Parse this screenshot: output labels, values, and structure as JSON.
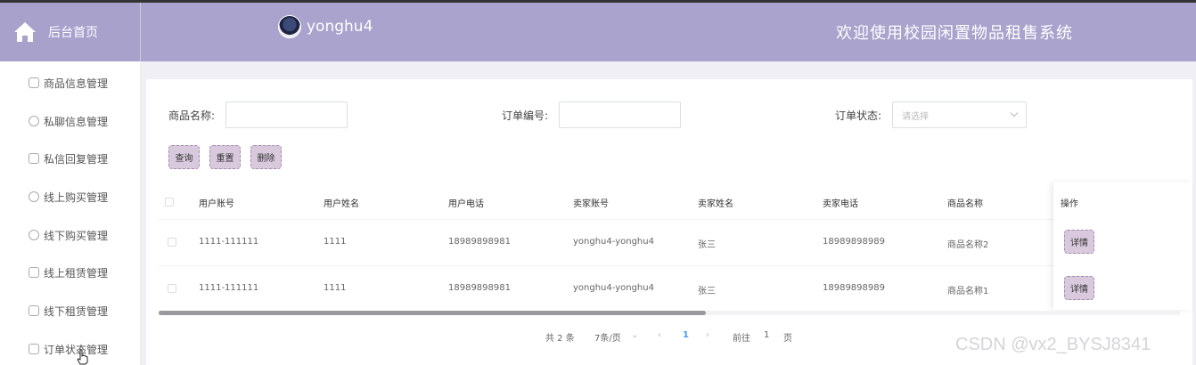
{
  "header": {
    "brand_label": "后台首页",
    "username": "yonghu4",
    "welcome": "欢迎使用校园闲置物品租售系统"
  },
  "sidebar": {
    "items": [
      {
        "label": "商品信息管理",
        "icon": "bag-icon"
      },
      {
        "label": "私聊信息管理",
        "icon": "chat-icon"
      },
      {
        "label": "私信回复管理",
        "icon": "star-icon"
      },
      {
        "label": "线上购买管理",
        "icon": "compass-icon"
      },
      {
        "label": "线下购买管理",
        "icon": "hand-icon"
      },
      {
        "label": "线上租赁管理",
        "icon": "calendar-check-icon"
      },
      {
        "label": "线下租赁管理",
        "icon": "bag-icon"
      },
      {
        "label": "订单状态管理",
        "icon": "calendar-check-icon"
      }
    ]
  },
  "filters": {
    "product_name_label": "商品名称:",
    "order_no_label": "订单编号:",
    "order_status_label": "订单状态:",
    "order_status_placeholder": "请选择"
  },
  "actions": {
    "query": "查询",
    "reset": "重置",
    "delete": "删除"
  },
  "table": {
    "columns": [
      "用户账号",
      "用户姓名",
      "用户电话",
      "卖家账号",
      "卖家姓名",
      "卖家电话",
      "商品名称",
      "操作"
    ],
    "rows": [
      [
        "1111-111111",
        "1111",
        "18989898981",
        "yonghu4-yonghu4",
        "张三",
        "18989898989",
        "商品名称2"
      ],
      [
        "1111-111111",
        "1111",
        "18989898981",
        "yonghu4-yonghu4",
        "张三",
        "18989898989",
        "商品名称1"
      ]
    ],
    "detail_label": "详情"
  },
  "pagination": {
    "total": "共 2 条",
    "page_size": "7条/页",
    "current": "1",
    "goto_prefix": "前往",
    "goto_value": "1",
    "goto_suffix": "页"
  },
  "watermark": "CSDN @vx2_BYSJ8341"
}
